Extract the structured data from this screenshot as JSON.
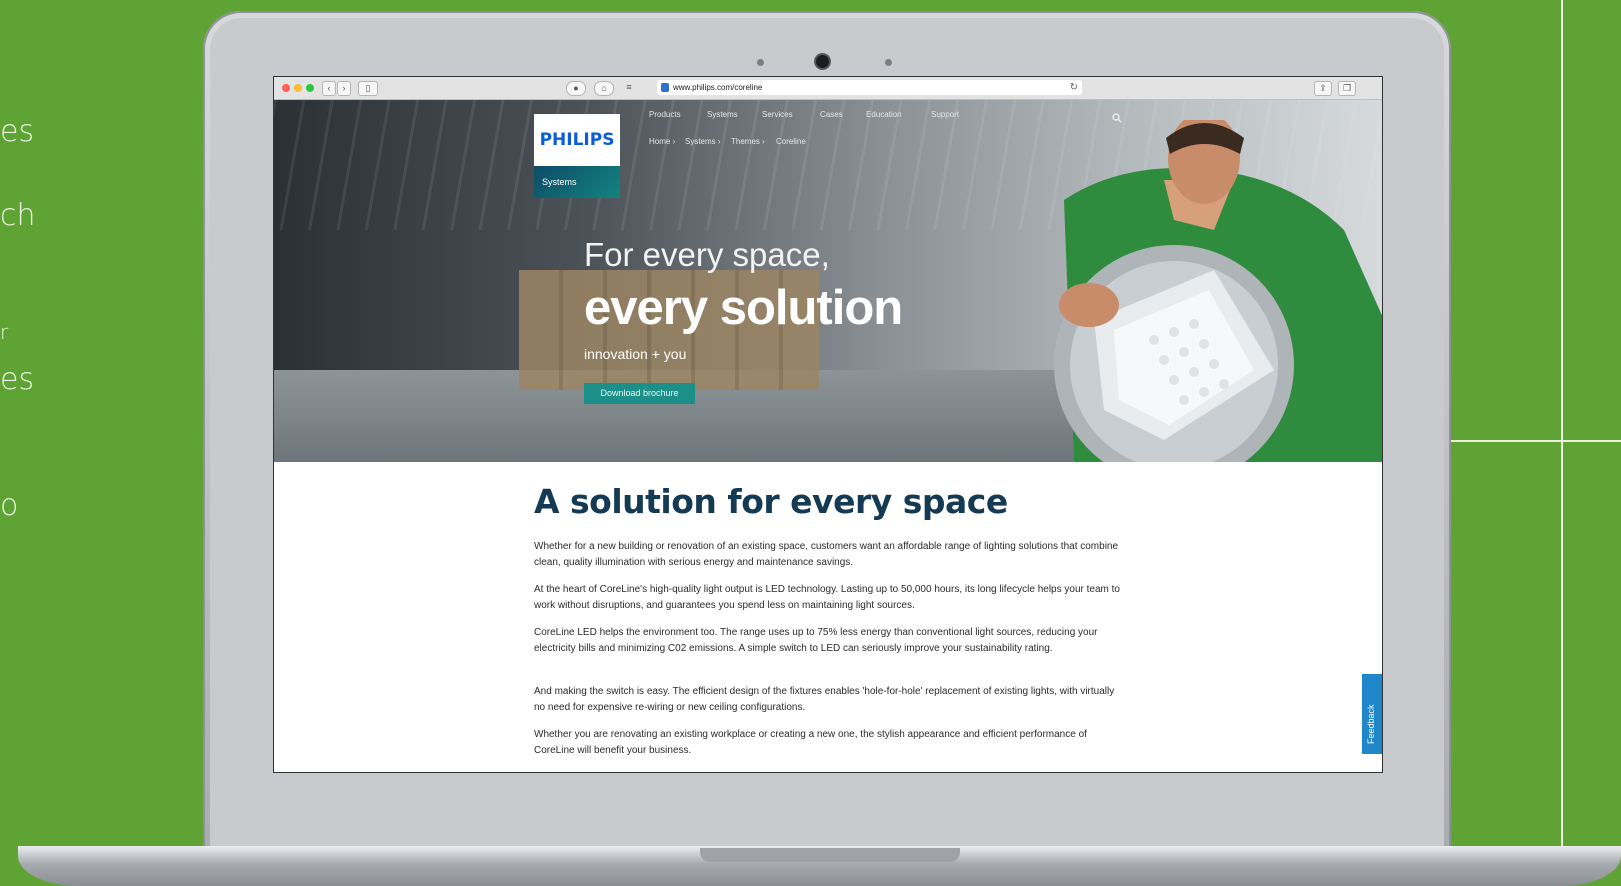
{
  "background": {
    "color": "#5ea334",
    "side_text_fragments": [
      "es",
      "ch",
      "r",
      "es",
      "o"
    ]
  },
  "browser": {
    "url": "www.philips.com/coreline",
    "traffic_lights": [
      "#ff5f57",
      "#febc2e",
      "#28c840"
    ],
    "icons": [
      "back-icon",
      "forward-icon",
      "sidebar-icon",
      "reader-icon",
      "lock-icon",
      "reload-icon",
      "share-icon",
      "tabs-icon"
    ]
  },
  "header": {
    "logo_text": "PHILIPS",
    "logo_subtitle": "Systems",
    "nav": [
      "Products",
      "Systems",
      "Services",
      "Cases",
      "Education",
      "Support"
    ],
    "breadcrumb": [
      "Home",
      "Systems",
      "Themes",
      "Coreline"
    ]
  },
  "hero": {
    "line1": "For every space,",
    "line2": "every solution",
    "tagline": "innovation + you",
    "button": "Download brochure"
  },
  "content": {
    "title": "A solution for every space",
    "paragraphs": [
      "Whether for a new building or renovation of an existing space, customers want an affordable range of lighting solutions that combine clean, quality illumination with serious energy and maintenance savings.",
      "At the heart of CoreLine's high-quality light output is LED technology. Lasting up to 50,000 hours, its long lifecycle helps your team to work without disruptions, and guarantees you spend less on maintaining light sources.",
      "CoreLine LED helps the environment too. The range uses up to 75% less energy than conventional light sources, reducing your electricity bills and minimizing C02 emissions. A simple switch to LED can seriously improve your sustainability rating.",
      "And making the switch is easy. The efficient design of the fixtures enables 'hole-for-hole' replacement of existing lights, with virtually no need for expensive re-wiring or new ceiling configurations.",
      "Whether you are renovating an existing workplace or creating a new one, the stylish appearance and efficient performance of CoreLine will benefit your business."
    ]
  },
  "feedback_tab": "Feedback",
  "colors": {
    "title": "#143b53",
    "button": "#1d8f89",
    "feedback": "#1f86c9",
    "logo_blue": "#0b5ed7"
  }
}
